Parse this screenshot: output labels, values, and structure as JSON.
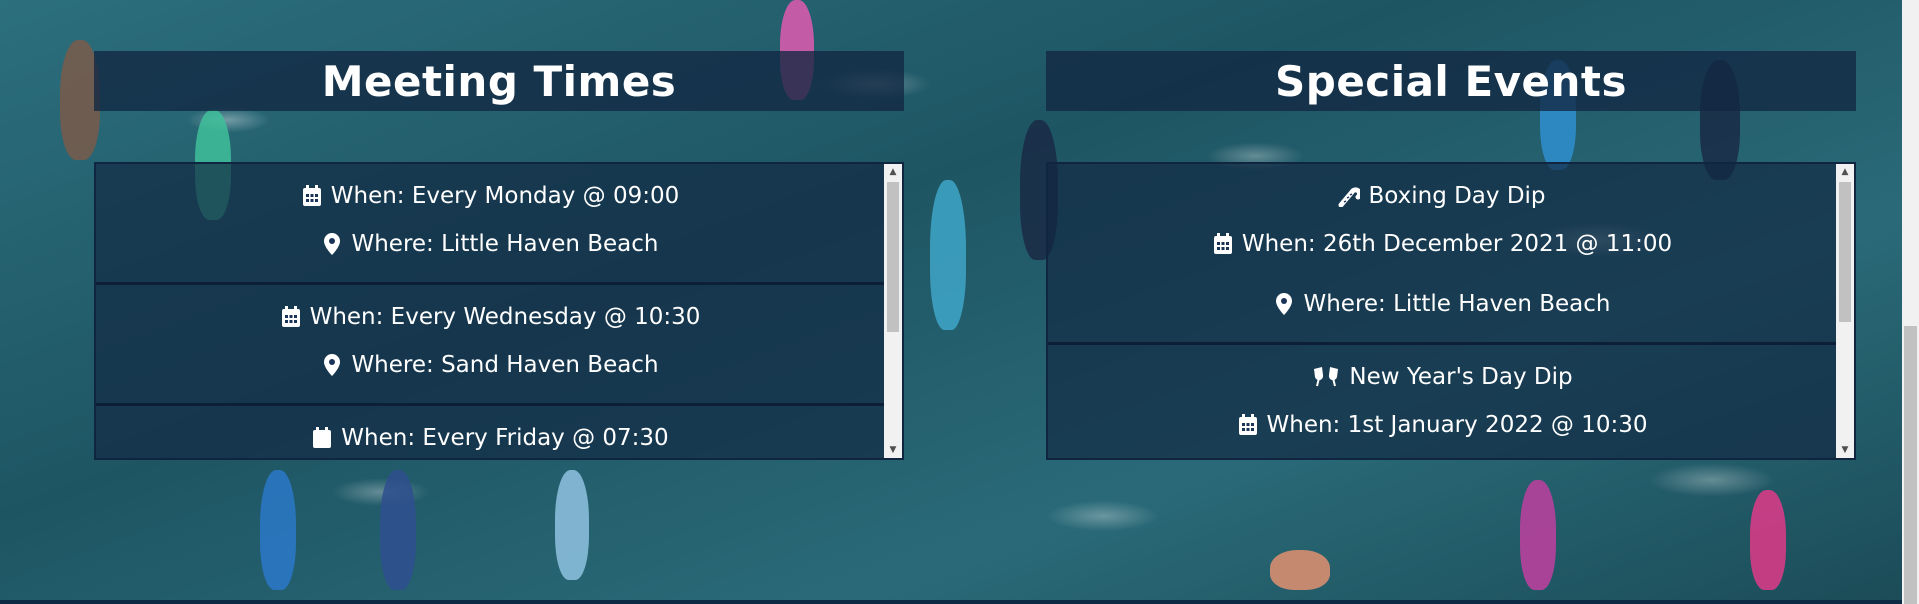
{
  "meeting": {
    "title": "Meeting Times",
    "items": [
      {
        "when": "When: Every Monday @ 09:00",
        "where": "Where: Little Haven Beach"
      },
      {
        "when": "When: Every Wednesday @ 10:30",
        "where": "Where: Sand Haven Beach"
      },
      {
        "when": "When: Every Friday @ 07:30",
        "where": ""
      }
    ]
  },
  "events": {
    "title": "Special Events",
    "items": [
      {
        "name": "Boxing Day Dip",
        "icon": "candy-cane-icon",
        "when": "When: 26th December 2021 @ 11:00",
        "where": "Where: Little Haven Beach"
      },
      {
        "name": "New Year's Day Dip",
        "icon": "glass-cheers-icon",
        "when": "When: 1st January 2022 @ 10:30",
        "where": ""
      }
    ]
  },
  "icons": {
    "calendar": "calendar-icon",
    "location": "map-marker-icon"
  },
  "colors": {
    "panel": "#12284A",
    "text": "#ffffff"
  }
}
